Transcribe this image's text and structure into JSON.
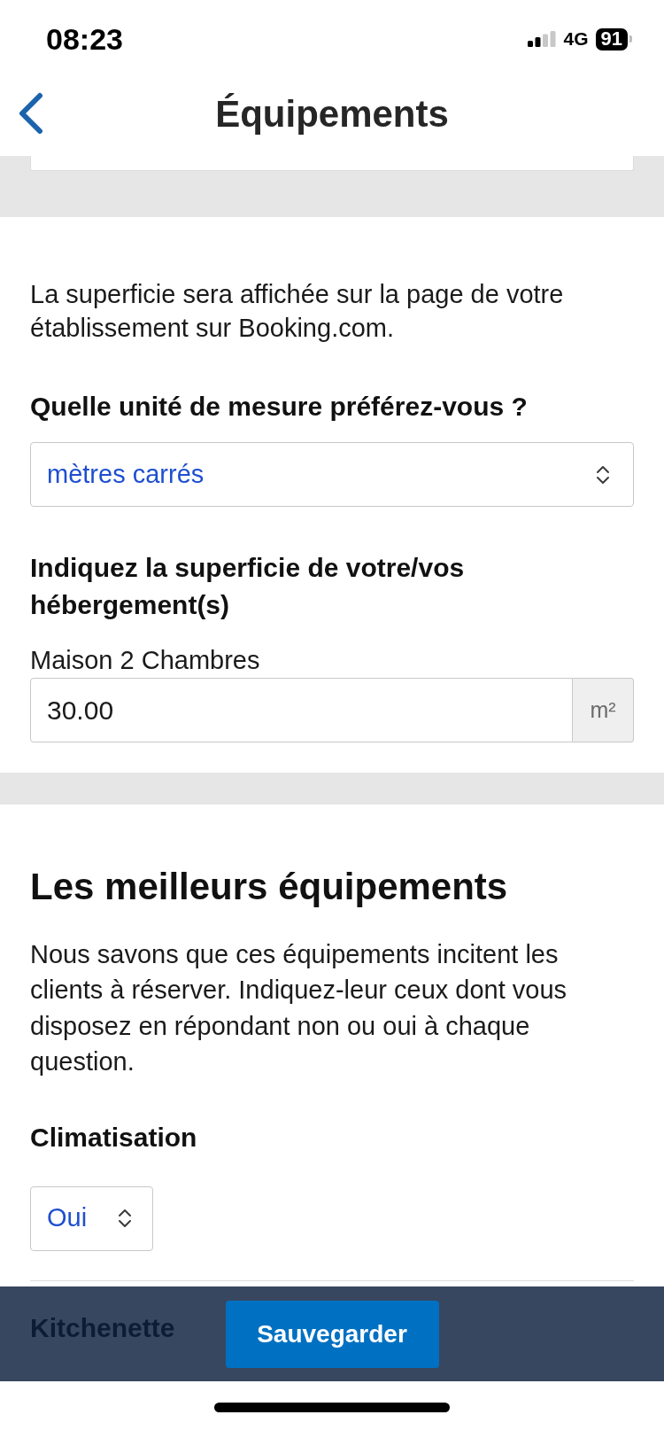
{
  "status_bar": {
    "time": "08:23",
    "network": "4G",
    "battery": "91"
  },
  "nav": {
    "title": "Équipements"
  },
  "area_section": {
    "description": "La superficie sera affichée sur la page de votre établissement sur Booking.com.",
    "unit_question": "Quelle unité de mesure préférez-vous ?",
    "unit_select": {
      "value": "mètres carrés"
    },
    "size_question": "Indiquez la superficie de votre/vos hébergement(s)",
    "rooms": [
      {
        "label": "Maison 2 Chambres",
        "value": "30.00",
        "unit": "m²"
      }
    ]
  },
  "amenities_section": {
    "title": "Les meilleurs équipements",
    "description": "Nous savons que ces équipements incitent les clients à réserver. Indiquez-leur ceux dont vous disposez en répondant non ou oui à chaque question.",
    "questions": [
      {
        "label": "Climatisation",
        "value": "Oui"
      },
      {
        "label": "Kitchenette"
      }
    ]
  },
  "save_button": "Sauvegarder"
}
